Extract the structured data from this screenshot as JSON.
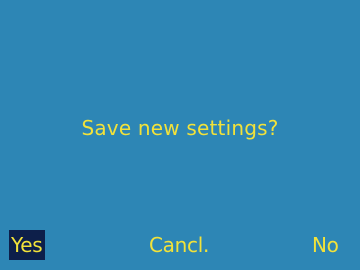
{
  "dialog": {
    "prompt": "Save new settings?"
  },
  "softkeys": {
    "left": {
      "label": "Yes",
      "selected": true
    },
    "center": {
      "label": "Cancl.",
      "selected": false
    },
    "right": {
      "label": "No",
      "selected": false
    }
  },
  "colors": {
    "background": "#2d86b5",
    "text": "#f2e23a",
    "selected_background": "#0d1f4a"
  }
}
